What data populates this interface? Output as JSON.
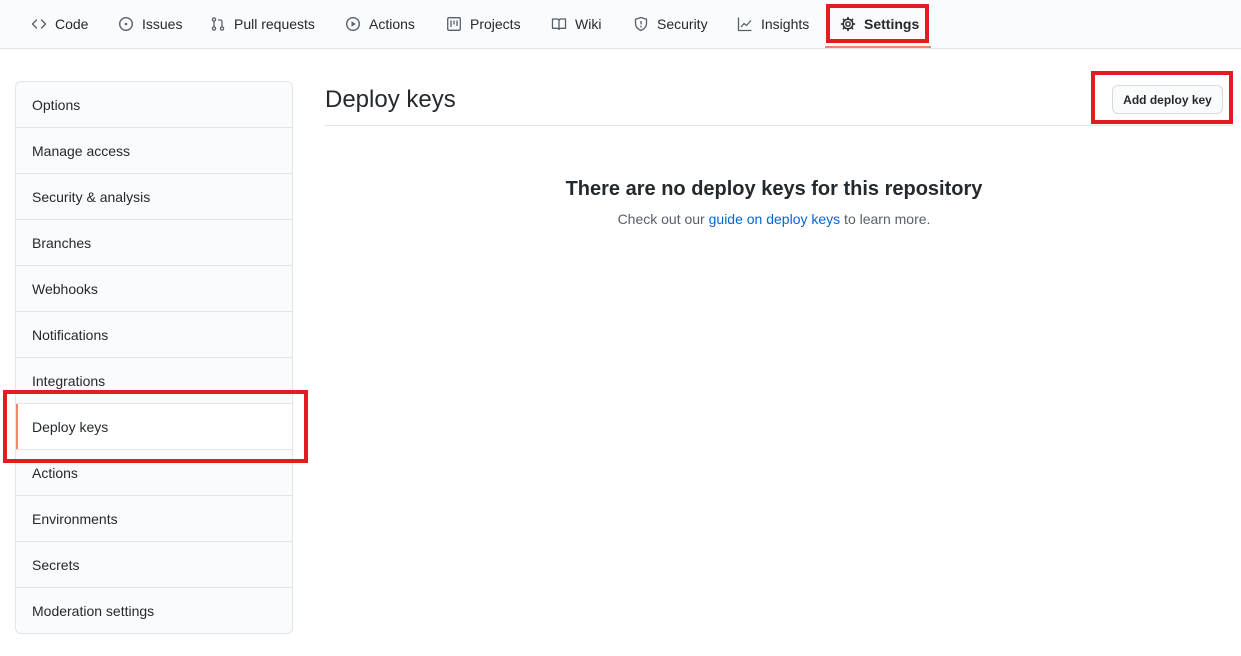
{
  "topnav": {
    "tabs": [
      {
        "label": "Code",
        "icon": "code-icon"
      },
      {
        "label": "Issues",
        "icon": "issue-opened-icon"
      },
      {
        "label": "Pull requests",
        "icon": "git-pull-request-icon"
      },
      {
        "label": "Actions",
        "icon": "play-icon"
      },
      {
        "label": "Projects",
        "icon": "project-icon"
      },
      {
        "label": "Wiki",
        "icon": "book-icon"
      },
      {
        "label": "Security",
        "icon": "shield-icon"
      },
      {
        "label": "Insights",
        "icon": "graph-icon"
      },
      {
        "label": "Settings",
        "icon": "gear-icon",
        "selected": true
      }
    ]
  },
  "sidebar": {
    "items": [
      {
        "label": "Options"
      },
      {
        "label": "Manage access"
      },
      {
        "label": "Security & analysis"
      },
      {
        "label": "Branches"
      },
      {
        "label": "Webhooks"
      },
      {
        "label": "Notifications"
      },
      {
        "label": "Integrations"
      },
      {
        "label": "Deploy keys",
        "selected": true
      },
      {
        "label": "Actions"
      },
      {
        "label": "Environments"
      },
      {
        "label": "Secrets"
      },
      {
        "label": "Moderation settings"
      }
    ]
  },
  "main": {
    "title": "Deploy keys",
    "add_button": "Add deploy key",
    "blankslate": {
      "heading": "There are no deploy keys for this repository",
      "text_before": "Check out our ",
      "link": "guide on deploy keys",
      "text_after": " to learn more."
    }
  },
  "colors": {
    "accent_underline": "#f9826c",
    "highlight_box": "#e31c23",
    "link": "#0366d6"
  }
}
